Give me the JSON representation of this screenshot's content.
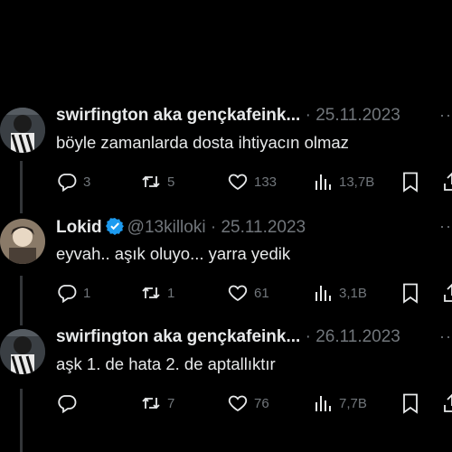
{
  "tweets": [
    {
      "name": "swirfington aka gençkafeink...",
      "handle": "",
      "separator": "·",
      "date": "25.11.2023",
      "more": "···",
      "text": "böyle zamanlarda dosta ihtiyacın olmaz",
      "replies": "3",
      "retweets": "5",
      "likes": "133",
      "views": "13,7B"
    },
    {
      "name": "Lokid",
      "handle": "@13killoki",
      "separator": "·",
      "date": "25.11.2023",
      "more": "···",
      "text": "eyvah.. aşık oluyo... yarra yedik",
      "replies": "1",
      "retweets": "1",
      "likes": "61",
      "views": "3,1B"
    },
    {
      "name": "swirfington aka gençkafeink...",
      "handle": "",
      "separator": "·",
      "date": "26.11.2023",
      "more": "···",
      "text": "aşk 1. de hata 2. de aptallıktır",
      "replies": "",
      "retweets": "7",
      "likes": "76",
      "views": "7,7B"
    }
  ],
  "icons": {
    "reply": "reply-icon",
    "retweet": "retweet-icon",
    "like": "heart-icon",
    "views": "views-icon",
    "bookmark": "bookmark-icon",
    "share": "share-icon"
  },
  "colors": {
    "background": "#000000",
    "text": "#e7e9ea",
    "muted": "#71767b",
    "verified": "#1d9bf0"
  }
}
